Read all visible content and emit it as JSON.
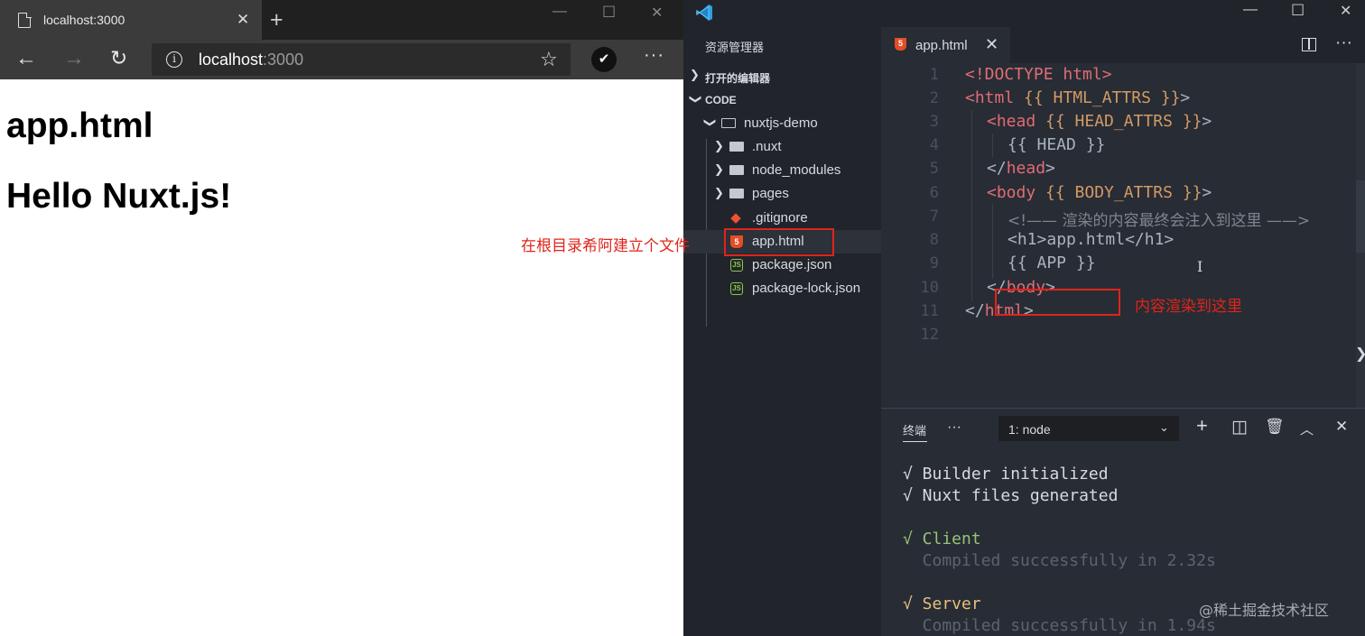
{
  "browser": {
    "tab_title": "localhost:3000",
    "url_host": "localhost",
    "url_port": ":3000",
    "page": {
      "heading1": "app.html",
      "heading2": "Hello Nuxt.js!"
    }
  },
  "annotations": {
    "left": "在根目录希阿建立个文件",
    "right": "内容渲染到这里"
  },
  "vscode": {
    "sidebar": {
      "title": "资源管理器",
      "open_editors": "打开的编辑器",
      "workspace": "CODE",
      "root_folder": "nuxtjs-demo",
      "items": [
        {
          "label": ".nuxt",
          "kind": "folder"
        },
        {
          "label": "node_modules",
          "kind": "folder"
        },
        {
          "label": "pages",
          "kind": "folder"
        },
        {
          "label": ".gitignore",
          "kind": "git"
        },
        {
          "label": "app.html",
          "kind": "html"
        },
        {
          "label": "package.json",
          "kind": "nodejs"
        },
        {
          "label": "package-lock.json",
          "kind": "nodejs"
        }
      ]
    },
    "editor": {
      "tab_label": "app.html",
      "line_numbers": [
        "1",
        "2",
        "3",
        "4",
        "5",
        "6",
        "7",
        "8",
        "9",
        "10",
        "11",
        "12"
      ],
      "lines": [
        {
          "p1": "<!DOCTYPE html>"
        },
        {
          "p1": "<html",
          "p2": " {{ HTML_ATTRS }}",
          "p3": ">"
        },
        {
          "p1": "<head",
          "p2": " {{ HEAD_ATTRS }}",
          "p3": ">"
        },
        {
          "p1": "{{ HEAD }}"
        },
        {
          "p1": "</",
          "p2": "head",
          "p3": ">"
        },
        {
          "p1": "<body",
          "p2": " {{ BODY_ATTRS }}",
          "p3": ">"
        },
        {
          "p1": "<!—— 渲染的内容最终会注入到这里 ——>"
        },
        {
          "p1": "<h1>",
          "p2": "app.html",
          "p3": "</h1>"
        },
        {
          "p1": "{{ APP }}"
        },
        {
          "p1": "</",
          "p2": "body",
          "p3": ">"
        },
        {
          "p1": "</",
          "p2": "html",
          "p3": ">"
        }
      ]
    },
    "panel": {
      "tab": "终端",
      "terminal_select": "1: node",
      "output": {
        "l1": "√ Builder initialized",
        "l2": "√ Nuxt files generated",
        "l3": "√ Client",
        "l4": "  Compiled successfully in 2.32s",
        "l5": "√ Server",
        "l6": "  Compiled successfully in 1.94s"
      }
    }
  },
  "watermark": "@稀土掘金技术社区"
}
